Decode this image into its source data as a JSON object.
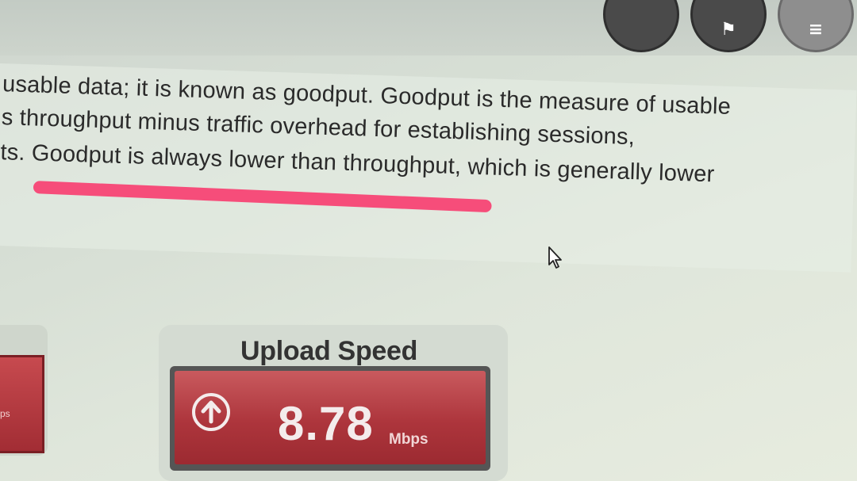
{
  "article": {
    "lines": [
      "usable data; it is known as goodput. Goodput is the measure of usable",
      "s throughput minus traffic overhead for establishing sessions,",
      "ts. Goodput is always lower than throughput, which is generally lower"
    ]
  },
  "left_card": {
    "unit_fragment": "ps"
  },
  "upload": {
    "title": "Upload Speed",
    "value": "8.78",
    "unit": "Mbps"
  },
  "colors": {
    "highlight": "#f64d7a",
    "speed_panel": "#ad353c"
  }
}
